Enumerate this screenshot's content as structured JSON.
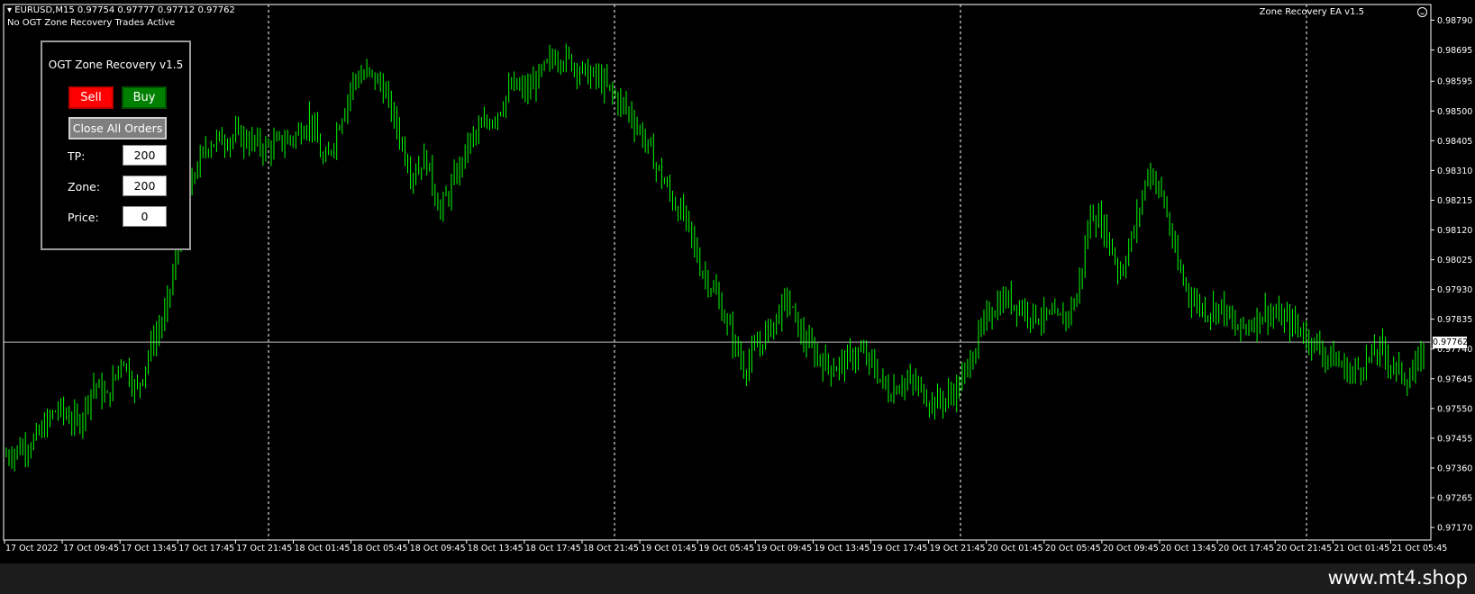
{
  "header": {
    "symbol_line": "EURUSD,M15  0.97754 0.97777 0.97712 0.97762",
    "status_line": "No OGT Zone Recovery Trades Active",
    "ea_label": "Zone Recovery EA  v1.5"
  },
  "panel": {
    "title": "OGT Zone Recovery v1.5",
    "sell_label": "Sell",
    "buy_label": "Buy",
    "close_label": "Close All Orders",
    "tp_label": "TP:",
    "tp_value": "200",
    "zone_label": "Zone:",
    "zone_value": "200",
    "price_label": "Price:",
    "price_value": "0"
  },
  "current_price": "0.97762",
  "footer": {
    "text": "www.mt4.shop"
  },
  "colors": {
    "candle": "#00ff00",
    "sell": "#ff0000",
    "buy": "#008000",
    "grid": "#ffffff"
  },
  "chart_data": {
    "type": "line",
    "symbol": "EURUSD",
    "timeframe": "M15",
    "y_ticks": [
      "0.98790",
      "0.98695",
      "0.98595",
      "0.98500",
      "0.98405",
      "0.98310",
      "0.98215",
      "0.98120",
      "0.98025",
      "0.97930",
      "0.97835",
      "0.97740",
      "0.97645",
      "0.97550",
      "0.97455",
      "0.97360",
      "0.97265",
      "0.97170"
    ],
    "x_ticks": [
      "17 Oct 2022",
      "17 Oct 09:45",
      "17 Oct 13:45",
      "17 Oct 17:45",
      "17 Oct 21:45",
      "18 Oct 01:45",
      "18 Oct 05:45",
      "18 Oct 09:45",
      "18 Oct 13:45",
      "18 Oct 17:45",
      "18 Oct 21:45",
      "19 Oct 01:45",
      "19 Oct 05:45",
      "19 Oct 09:45",
      "19 Oct 13:45",
      "19 Oct 17:45",
      "19 Oct 21:45",
      "20 Oct 01:45",
      "20 Oct 05:45",
      "20 Oct 09:45",
      "20 Oct 13:45",
      "20 Oct 17:45",
      "20 Oct 21:45",
      "21 Oct 01:45",
      "21 Oct 05:45"
    ],
    "ylim": [
      0.9713,
      0.9884
    ],
    "current_price": 0.97762,
    "price_path": [
      [
        0,
        0.974
      ],
      [
        2,
        0.9745
      ],
      [
        3.5,
        0.9755
      ],
      [
        5,
        0.975
      ],
      [
        6,
        0.9763
      ],
      [
        7,
        0.9758
      ],
      [
        8,
        0.9772
      ],
      [
        9,
        0.976
      ],
      [
        10,
        0.9775
      ],
      [
        11,
        0.9785
      ],
      [
        12,
        0.981
      ],
      [
        13,
        0.983
      ],
      [
        14,
        0.984
      ],
      [
        16,
        0.9842
      ],
      [
        18,
        0.9838
      ],
      [
        20,
        0.9842
      ],
      [
        21,
        0.9848
      ],
      [
        22,
        0.9832
      ],
      [
        24,
        0.986
      ],
      [
        25,
        0.9862
      ],
      [
        26,
        0.9858
      ],
      [
        27,
        0.9845
      ],
      [
        28,
        0.983
      ],
      [
        29,
        0.9835
      ],
      [
        30,
        0.9818
      ],
      [
        31,
        0.9828
      ],
      [
        32,
        0.984
      ],
      [
        33,
        0.9845
      ],
      [
        34,
        0.985
      ],
      [
        35,
        0.9858
      ],
      [
        36,
        0.9856
      ],
      [
        37,
        0.9862
      ],
      [
        38,
        0.9868
      ],
      [
        39,
        0.9866
      ],
      [
        40,
        0.9862
      ],
      [
        41,
        0.986
      ],
      [
        42,
        0.9855
      ],
      [
        43,
        0.985
      ],
      [
        44,
        0.9842
      ],
      [
        45,
        0.9832
      ],
      [
        46,
        0.9822
      ],
      [
        47,
        0.9815
      ],
      [
        48,
        0.98
      ],
      [
        49,
        0.9792
      ],
      [
        50,
        0.978
      ],
      [
        51,
        0.9768
      ],
      [
        52,
        0.9775
      ],
      [
        53,
        0.9782
      ],
      [
        54,
        0.979
      ],
      [
        55,
        0.9778
      ],
      [
        56,
        0.9772
      ],
      [
        57,
        0.9768
      ],
      [
        58,
        0.977
      ],
      [
        59,
        0.9773
      ],
      [
        60,
        0.9768
      ],
      [
        61,
        0.976
      ],
      [
        62,
        0.9764
      ],
      [
        63,
        0.9762
      ],
      [
        64,
        0.9757
      ],
      [
        65,
        0.9758
      ],
      [
        66,
        0.9763
      ],
      [
        67,
        0.9775
      ],
      [
        68,
        0.9786
      ],
      [
        69,
        0.979
      ],
      [
        70,
        0.9788
      ],
      [
        71,
        0.9785
      ],
      [
        72,
        0.9784
      ],
      [
        73,
        0.9783
      ],
      [
        74,
        0.979
      ],
      [
        75,
        0.9818
      ],
      [
        76,
        0.9812
      ],
      [
        77,
        0.9798
      ],
      [
        78,
        0.9812
      ],
      [
        79,
        0.9832
      ],
      [
        80,
        0.9822
      ],
      [
        81,
        0.98
      ],
      [
        82,
        0.979
      ],
      [
        83,
        0.9786
      ],
      [
        84,
        0.9788
      ],
      [
        85,
        0.978
      ],
      [
        86,
        0.9782
      ],
      [
        87,
        0.9786
      ],
      [
        88,
        0.9784
      ],
      [
        89,
        0.9782
      ],
      [
        90,
        0.9778
      ],
      [
        91,
        0.9773
      ],
      [
        92,
        0.977
      ],
      [
        93,
        0.9766
      ],
      [
        94,
        0.977
      ],
      [
        95,
        0.9774
      ],
      [
        96,
        0.9768
      ],
      [
        97,
        0.9764
      ],
      [
        98,
        0.9773
      ]
    ]
  }
}
